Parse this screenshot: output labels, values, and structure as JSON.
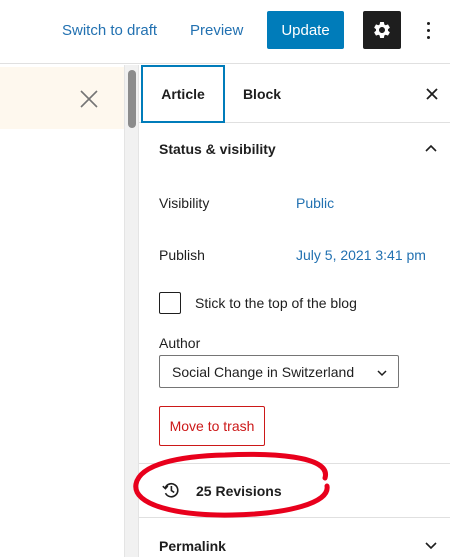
{
  "toolbar": {
    "switch_to_draft": "Switch to draft",
    "preview": "Preview",
    "update": "Update"
  },
  "sidebar": {
    "tabs": [
      {
        "label": "Article",
        "active": true
      },
      {
        "label": "Block",
        "active": false
      }
    ],
    "status_panel": {
      "title": "Status & visibility",
      "visibility_label": "Visibility",
      "visibility_value": "Public",
      "publish_label": "Publish",
      "publish_value": "July 5, 2021 3:41 pm",
      "stick_label": "Stick to the top of the blog",
      "stick_checked": false,
      "author_label": "Author",
      "author_value": "Social Change in Switzerland",
      "trash_label": "Move to trash"
    },
    "revisions_label": "25 Revisions",
    "permalink_title": "Permalink"
  },
  "icons": {
    "settings": "gear-icon",
    "more": "more-vertical-icon",
    "notice_close": "close-icon",
    "tab_close": "close-icon",
    "collapse": "chevron-up-icon",
    "expand": "chevron-down-icon",
    "revisions": "history-icon"
  },
  "colors": {
    "accent": "#007cba",
    "link": "#2271b1",
    "danger": "#cc1818",
    "notice_bg": "#fef8ee",
    "annotation": "#e8001c"
  }
}
